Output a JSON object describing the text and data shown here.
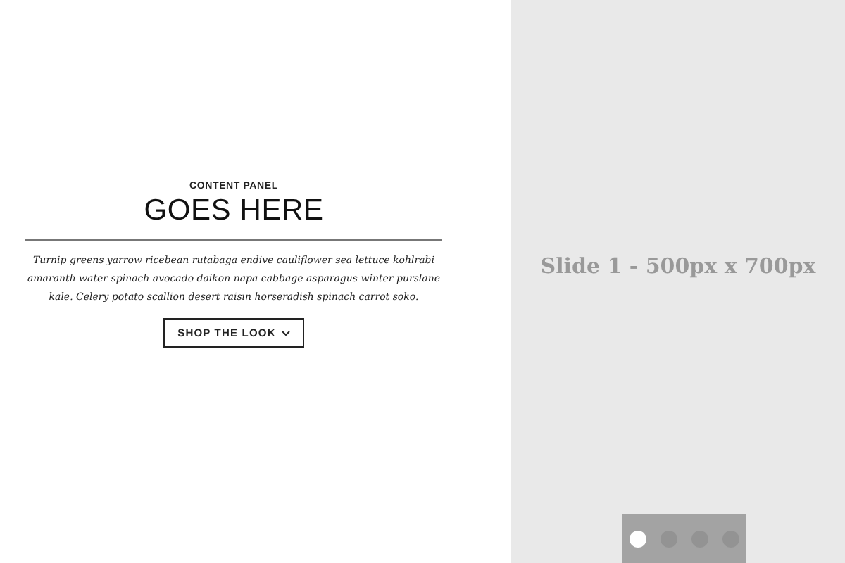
{
  "content_panel": {
    "eyebrow": "CONTENT PANEL",
    "heading": "GOES HERE",
    "body": "Turnip greens yarrow ricebean rutabaga endive cauliflower sea lettuce kohlrabi amaranth water spinach avocado daikon napa cabbage asparagus winter purslane kale. Celery potato scallion desert raisin horseradish spinach carrot soko.",
    "button": "SHOP THE LOOK"
  },
  "slide": {
    "label": "Slide 1 - 500px x 700px"
  },
  "pager": [
    {
      "selected": true
    },
    {
      "selected": false
    },
    {
      "selected": false
    },
    {
      "selected": false
    }
  ]
}
